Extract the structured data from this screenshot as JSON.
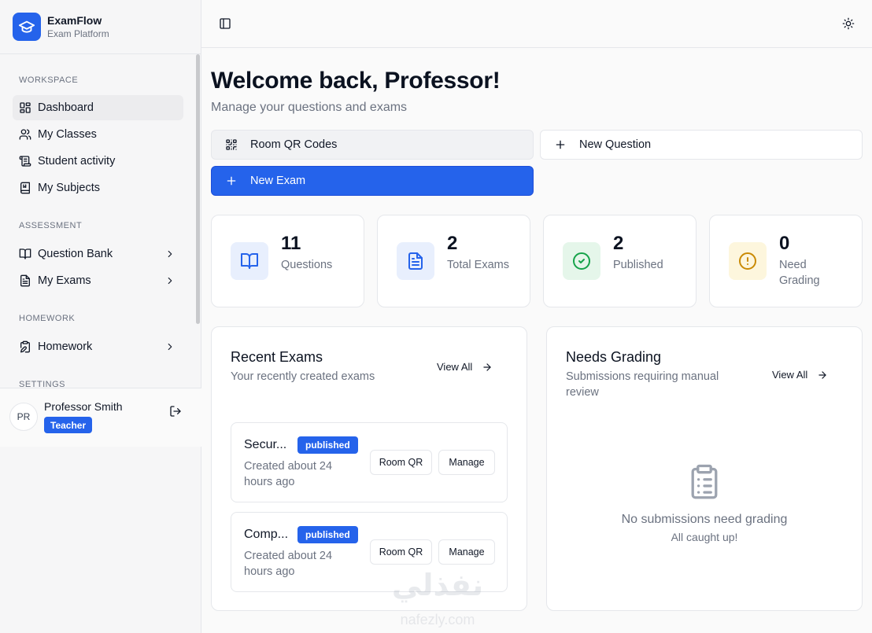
{
  "brand": {
    "name": "ExamFlow",
    "subtitle": "Exam Platform"
  },
  "sidebar": {
    "sections": [
      {
        "label": "WORKSPACE"
      },
      {
        "label": "ASSESSMENT"
      },
      {
        "label": "HOMEWORK"
      },
      {
        "label": "SETTINGS"
      }
    ],
    "items": [
      {
        "label": "Dashboard",
        "icon": "dashboard-icon",
        "active": true
      },
      {
        "label": "My Classes",
        "icon": "users-icon"
      },
      {
        "label": "Student activity",
        "icon": "scroll-icon"
      },
      {
        "label": "My Subjects",
        "icon": "book-icon"
      },
      {
        "label": "Question Bank",
        "icon": "book-open-icon",
        "expandable": true
      },
      {
        "label": "My Exams",
        "icon": "file-text-icon",
        "expandable": true
      },
      {
        "label": "Homework",
        "icon": "clipboard-pen-icon",
        "expandable": true
      }
    ]
  },
  "user": {
    "initials": "PR",
    "name": "Professor Smith",
    "role": "Teacher"
  },
  "header": {
    "title": "Welcome back, Professor!",
    "subtitle": "Manage your questions and exams"
  },
  "actions": {
    "room_qr": "Room QR Codes",
    "new_question": "New Question",
    "new_exam": "New Exam"
  },
  "stats": [
    {
      "value": "11",
      "label": "Questions",
      "icon": "book-open-icon",
      "bg": "#e8effd",
      "color": "#2563eb"
    },
    {
      "value": "2",
      "label": "Total Exams",
      "icon": "file-text-icon",
      "bg": "#e8effd",
      "color": "#2563eb"
    },
    {
      "value": "2",
      "label": "Published",
      "icon": "check-circle-icon",
      "bg": "#e5f6ea",
      "color": "#16a34a"
    },
    {
      "value": "0",
      "label": "Need Grading",
      "icon": "alert-circle-icon",
      "bg": "#fdf6dd",
      "color": "#ca8a04"
    }
  ],
  "recent_exams": {
    "title": "Recent Exams",
    "subtitle": "Your recently created exams",
    "view_all": "View All",
    "items": [
      {
        "title": "Secur...",
        "status": "published",
        "meta": "Created about 24 hours ago",
        "qr_label": "Room QR",
        "manage_label": "Manage"
      },
      {
        "title": "Comp...",
        "status": "published",
        "meta": "Created about 24 hours ago",
        "qr_label": "Room QR",
        "manage_label": "Manage"
      }
    ]
  },
  "needs_grading": {
    "title": "Needs Grading",
    "subtitle": "Submissions requiring manual review",
    "view_all": "View All",
    "empty_title": "No submissions need grading",
    "empty_sub": "All caught up!"
  },
  "watermark": {
    "arabic": "نفذلي",
    "latin": "nafezly.com"
  }
}
